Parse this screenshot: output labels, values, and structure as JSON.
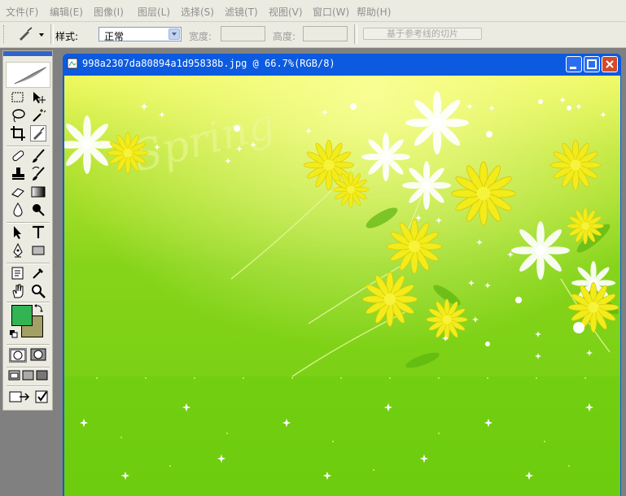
{
  "menu": [
    {
      "label": "文件(F)"
    },
    {
      "label": "编辑(E)"
    },
    {
      "label": "图像(I)"
    },
    {
      "label": "图层(L)"
    },
    {
      "label": "选择(S)"
    },
    {
      "label": "滤镜(T)"
    },
    {
      "label": "视图(V)"
    },
    {
      "label": "窗口(W)"
    },
    {
      "label": "帮助(H)"
    }
  ],
  "options": {
    "style_label": "样式:",
    "style_value": "正常",
    "width_label": "宽度:",
    "width_value": "",
    "height_label": "高度:",
    "height_value": "",
    "slice_button": "基于参考线的切片"
  },
  "tools": {
    "active": "slice-tool",
    "items": [
      "marquee-tool",
      "move-tool",
      "lasso-tool",
      "magic-wand-tool",
      "crop-tool",
      "slice-tool",
      "healing-brush-tool",
      "brush-tool",
      "clone-stamp-tool",
      "history-brush-tool",
      "eraser-tool",
      "gradient-tool",
      "blur-tool",
      "dodge-tool",
      "path-selection-tool",
      "type-tool",
      "pen-tool",
      "rectangle-tool",
      "notes-tool",
      "eyedropper-tool",
      "hand-tool",
      "zoom-tool"
    ],
    "foreground_color": "#32b454",
    "background_color": "#a2a064"
  },
  "document": {
    "title": "998a2307da80894a1d95838b.jpg @ 66.7%(RGB/8)",
    "image_text": "Spring"
  }
}
